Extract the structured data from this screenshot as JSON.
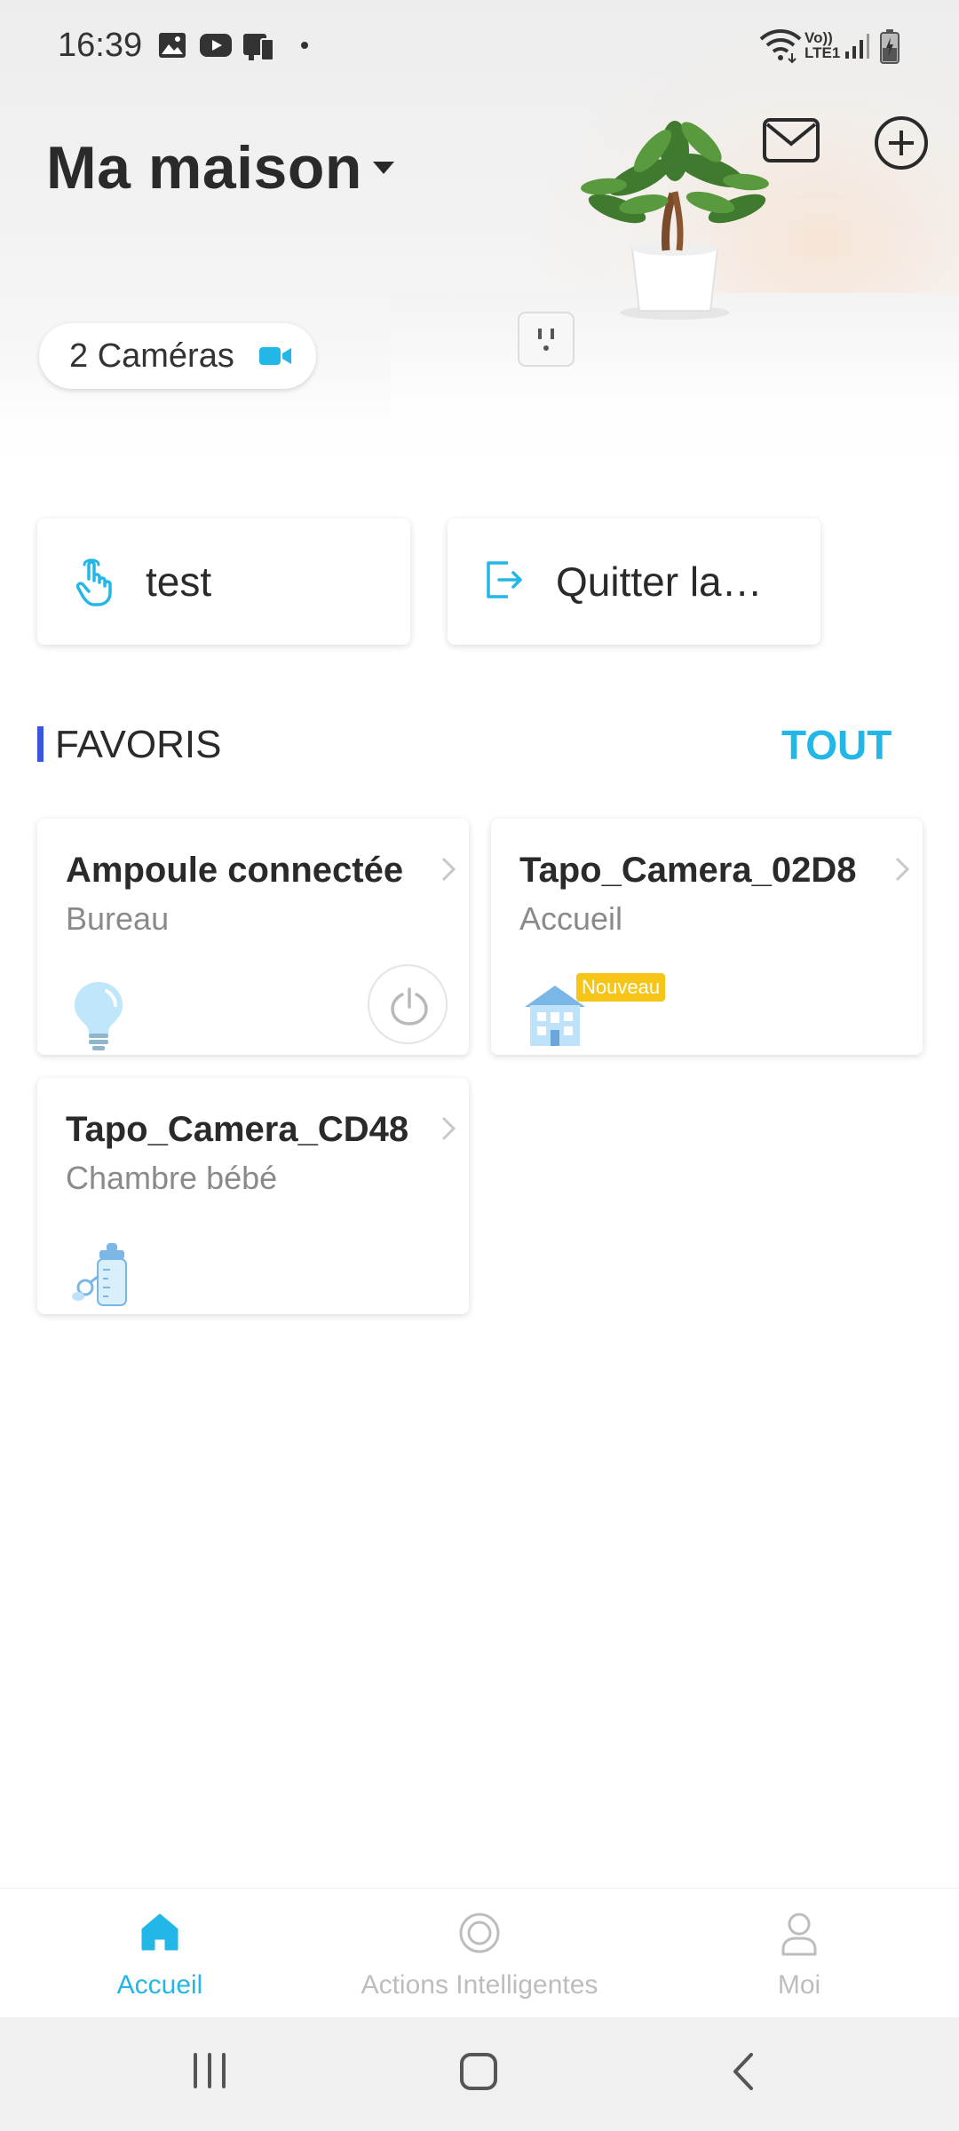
{
  "status_bar": {
    "time": "16:39",
    "network_label": "Vo)) LTE1"
  },
  "header": {
    "home_name": "Ma maison",
    "cameras_chip": "2 Caméras"
  },
  "quick_actions": [
    {
      "label": "test",
      "icon": "tap-hand-icon"
    },
    {
      "label": "Quitter la…",
      "icon": "exit-icon"
    }
  ],
  "favorites": {
    "title": "FAVORIS",
    "see_all": "TOUT",
    "devices": [
      {
        "name": "Ampoule connectée",
        "room": "Bureau",
        "icon": "bulb-icon"
      },
      {
        "name": "Tapo_Camera_02D8",
        "room": "Accueil",
        "icon": "house-icon",
        "badge": "Nouveau"
      },
      {
        "name": "Tapo_Camera_CD48",
        "room": "Chambre bébé",
        "icon": "baby-bottle-icon"
      }
    ]
  },
  "bottom_nav": {
    "items": [
      {
        "label": "Accueil",
        "active": true
      },
      {
        "label": "Actions Intelligentes",
        "active": false
      },
      {
        "label": "Moi",
        "active": false
      }
    ]
  },
  "colors": {
    "accent": "#22b7e6",
    "favorites_bar": "#3a56e0",
    "badge": "#f5c518"
  }
}
